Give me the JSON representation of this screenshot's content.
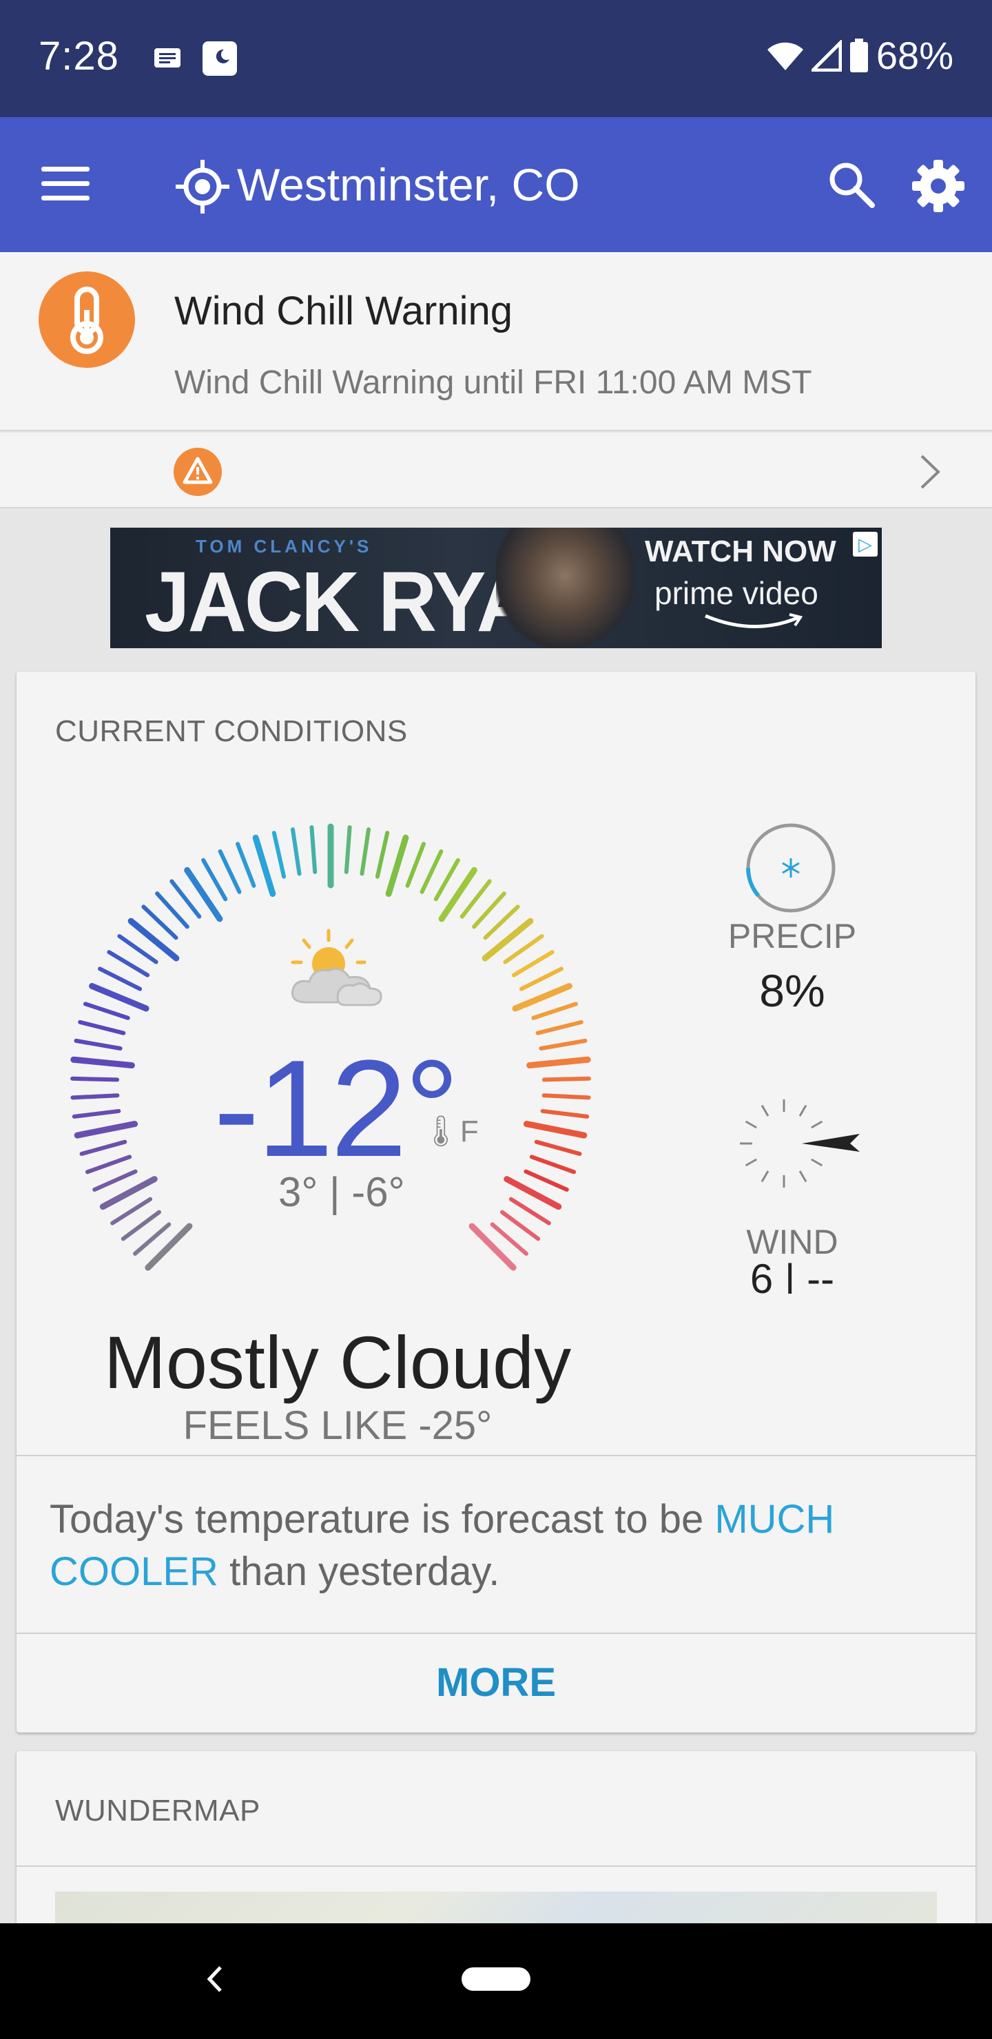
{
  "status_bar": {
    "time": "7:28",
    "battery": "68%",
    "icons": [
      "news-icon",
      "moon-icon",
      "wifi-icon",
      "signal-icon",
      "battery-icon"
    ]
  },
  "app_bar": {
    "location": "Westminster, CO",
    "icons": [
      "menu-icon",
      "location-icon",
      "search-icon",
      "gear-icon"
    ]
  },
  "alert": {
    "title": "Wind Chill Warning",
    "subtitle": "Wind Chill Warning until FRI 11:00 AM MST",
    "accent_color": "#f28a3c"
  },
  "ad": {
    "tagline": "TOM CLANCY'S",
    "title": "JACK RYAN",
    "cta": "WATCH NOW",
    "brand": "prime video"
  },
  "conditions": {
    "header": "CURRENT CONDITIONS",
    "temperature": "-12°",
    "unit": "F",
    "hi_lo": "3° | -6°",
    "condition": "Mostly Cloudy",
    "feels_like": "FEELS LIKE -25°",
    "weather_icon": "partly-cloudy-icon",
    "temp_color": "#4659c6",
    "precip_label": "PRECIP",
    "precip_value": "8%",
    "precip_fraction": 0.08,
    "wind_label": "WIND",
    "wind_value": "6 | --"
  },
  "forecast_note": {
    "before": "Today's temperature is forecast to be ",
    "highlight": "MUCH COOLER",
    "after": " than yesterday.",
    "highlight_color": "#2aa3d8"
  },
  "more_label": "MORE",
  "map_card": {
    "header": "WUNDERMAP"
  }
}
